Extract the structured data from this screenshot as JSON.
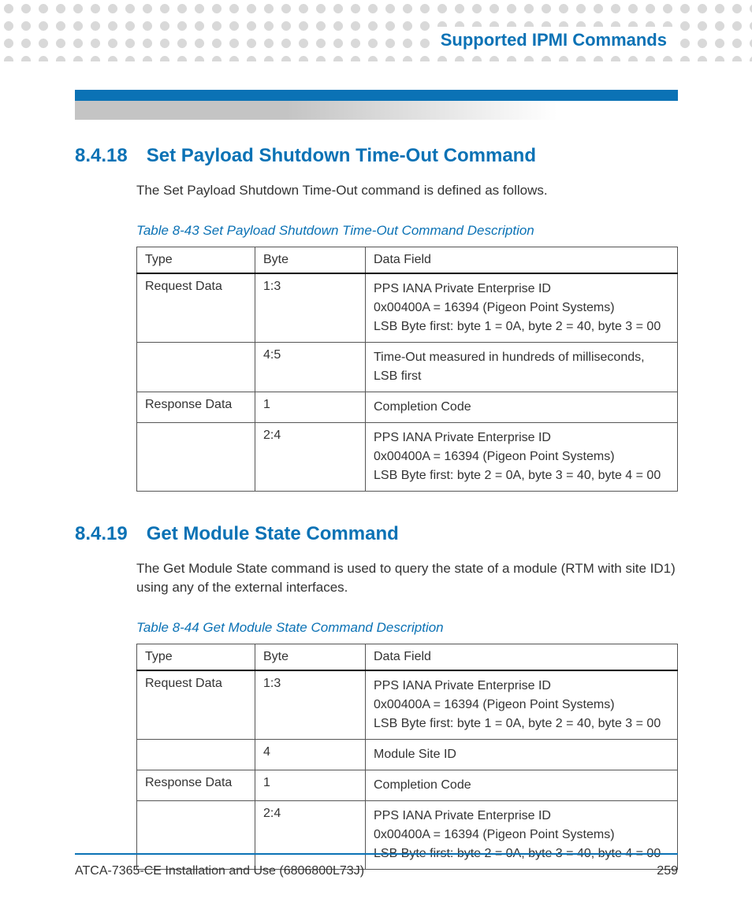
{
  "header": {
    "title": "Supported IPMI Commands"
  },
  "sections": [
    {
      "number": "8.4.18",
      "title": "Set Payload Shutdown Time-Out Command",
      "intro": "The Set Payload Shutdown Time-Out command is defined as follows.",
      "table_caption": "Table 8-43 Set Payload Shutdown Time-Out Command Description",
      "table_headers": {
        "c1": "Type",
        "c2": "Byte",
        "c3": "Data Field"
      },
      "rows": [
        {
          "type": "Request Data",
          "byte": "1:3",
          "data": [
            "PPS IANA Private Enterprise ID",
            "0x00400A = 16394 (Pigeon Point Systems)",
            "LSB Byte first: byte 1 = 0A, byte 2 = 40, byte 3 = 00"
          ]
        },
        {
          "type": "",
          "byte": "4:5",
          "data": [
            "Time-Out measured in hundreds of milliseconds, LSB first"
          ]
        },
        {
          "type": "Response Data",
          "byte": "1",
          "data": [
            "Completion Code"
          ]
        },
        {
          "type": "",
          "byte": "2:4",
          "data": [
            "PPS IANA Private Enterprise ID",
            "0x00400A = 16394 (Pigeon Point Systems)",
            "LSB Byte first: byte 2 = 0A, byte 3 = 40, byte 4 = 00"
          ]
        }
      ]
    },
    {
      "number": "8.4.19",
      "title": "Get Module State Command",
      "intro": "The Get Module State command is used to query the state of a module (RTM with site ID1) using any of the external interfaces.",
      "table_caption": "Table 8-44 Get Module State Command Description",
      "table_headers": {
        "c1": "Type",
        "c2": "Byte",
        "c3": "Data Field"
      },
      "rows": [
        {
          "type": "Request Data",
          "byte": "1:3",
          "data": [
            "PPS IANA Private Enterprise ID",
            "0x00400A = 16394 (Pigeon Point Systems)",
            "LSB Byte first: byte 1 = 0A, byte 2 = 40, byte 3 = 00"
          ]
        },
        {
          "type": "",
          "byte": "4",
          "data": [
            "Module Site ID"
          ]
        },
        {
          "type": "Response Data",
          "byte": "1",
          "data": [
            "Completion Code"
          ]
        },
        {
          "type": "",
          "byte": "2:4",
          "data": [
            "PPS IANA Private Enterprise ID",
            "0x00400A = 16394 (Pigeon Point Systems)",
            "LSB Byte first: byte 2 = 0A, byte 3 = 40, byte 4 = 00"
          ]
        }
      ]
    }
  ],
  "footer": {
    "doc": "ATCA-7365-CE Installation and Use (6806800L73J)",
    "page": "259"
  }
}
